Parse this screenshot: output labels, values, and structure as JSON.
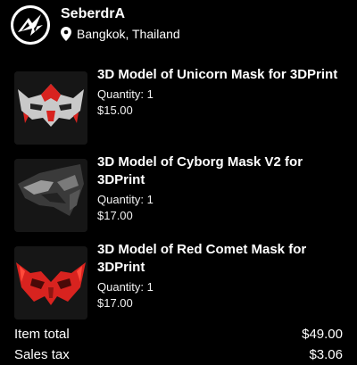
{
  "shop": {
    "name": "SeberdrA",
    "location": "Bangkok, Thailand",
    "icons": {
      "avatar": "shop-logo",
      "location": "map-pin-icon"
    }
  },
  "items": [
    {
      "title": "3D Model of Unicorn Mask for 3DPrint",
      "quantity": "Quantity: 1",
      "price": "$15.00",
      "thumbnail": "unicorn-mask-image"
    },
    {
      "title": "3D Model of Cyborg Mask V2 for 3DPrint",
      "quantity": "Quantity: 1",
      "price": "$17.00",
      "thumbnail": "cyborg-mask-image"
    },
    {
      "title": "3D Model of Red Comet Mask for 3DPrint",
      "quantity": "Quantity: 1",
      "price": "$17.00",
      "thumbnail": "red-comet-mask-image"
    }
  ],
  "summary": {
    "item_total_label": "Item total",
    "item_total_value": "$49.00",
    "sales_tax_label": "Sales tax",
    "sales_tax_value": "$3.06"
  },
  "colors": {
    "background": "#000000",
    "text": "#ffffff",
    "mask_red": "#d8231f",
    "mask_silver": "#c9c9c9"
  }
}
